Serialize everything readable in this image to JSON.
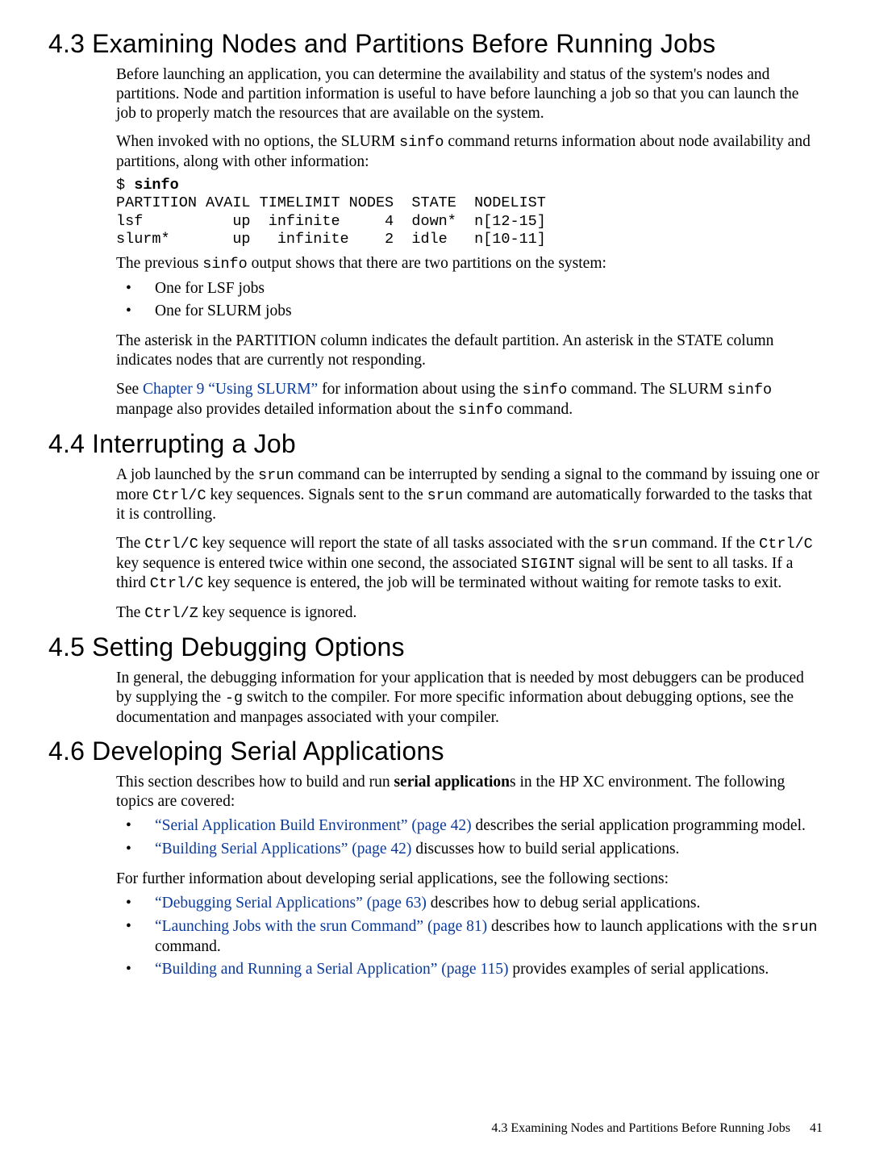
{
  "sections": {
    "s43": {
      "title": "4.3 Examining Nodes and Partitions Before Running Jobs",
      "p1": "Before launching an application, you can determine the availability and status of the system's nodes and partitions. Node and partition information is useful to have before launching a job so that you can launch the job to properly match the resources that are available on the system.",
      "p2_pre": "When invoked with no options, the SLURM ",
      "p2_code": "sinfo",
      "p2_post": " command returns information about node availability and partitions, along with other information:",
      "code_lines": {
        "prompt_pre": "$ ",
        "prompt_cmd": "sinfo",
        "header": "PARTITION AVAIL TIMELIMIT NODES  STATE  NODELIST",
        "row1": "lsf          up  infinite     4  down*  n[12-15]",
        "row2": "slurm*       up   infinite    2  idle   n[10-11]"
      },
      "p3_pre": "The previous ",
      "p3_code": "sinfo",
      "p3_post": " output shows that there are two partitions on the system:",
      "bullets": {
        "b1": "One for LSF jobs",
        "b2": "One for SLURM jobs"
      },
      "p4": "The asterisk in the PARTITION column indicates the default partition. An asterisk in the STATE column indicates nodes that are currently not responding.",
      "p5_pre": "See ",
      "p5_link": "Chapter 9 “Using SLURM”",
      "p5_mid": " for information about using the ",
      "p5_code1": "sinfo",
      "p5_mid2": " command. The SLURM ",
      "p5_code2": "sinfo",
      "p5_mid3": " manpage also provides detailed information about the ",
      "p5_code3": "sinfo",
      "p5_post": " command."
    },
    "s44": {
      "title": "4.4 Interrupting a Job",
      "p1_pre": "A job launched by the ",
      "p1_code1": "srun",
      "p1_mid1": " command can be interrupted by sending a signal to the command by issuing one or more ",
      "p1_code2": "Ctrl/C",
      "p1_mid2": " key sequences. Signals sent to the ",
      "p1_code3": "srun",
      "p1_post": " command are automatically forwarded to the tasks that it is controlling.",
      "p2_pre": "The ",
      "p2_code1": "Ctrl/C",
      "p2_mid1": " key sequence will report the state of all tasks associated with the ",
      "p2_code2": "srun",
      "p2_mid2": " command. If the ",
      "p2_code3": "Ctrl/C",
      "p2_mid3": " key sequence is entered twice within one second, the associated ",
      "p2_code4": "SIGINT",
      "p2_mid4": " signal will be sent to all tasks. If a third ",
      "p2_code5": "Ctrl/C",
      "p2_post": " key sequence is entered, the job will be terminated without waiting for remote tasks to exit.",
      "p3_pre": "The ",
      "p3_code": "Ctrl/Z",
      "p3_post": " key sequence is ignored."
    },
    "s45": {
      "title": "4.5 Setting Debugging Options",
      "p1_pre": "In general, the debugging information for your application that is needed by most debuggers can be produced by supplying the ",
      "p1_code": "-g",
      "p1_post": " switch to the compiler. For more specific information about debugging options, see the documentation and manpages associated with your compiler."
    },
    "s46": {
      "title": "4.6 Developing Serial Applications",
      "p1_pre": "This section describes how to build and run ",
      "p1_bold": "serial application",
      "p1_post": "s in the HP XC environment. The following topics are covered:",
      "list1": {
        "b1_link": "“Serial Application Build Environment” (page 42)",
        "b1_tail": " describes the serial application programming model.",
        "b2_link": "“Building Serial Applications” (page 42)",
        "b2_tail": " discusses how to build serial applications."
      },
      "p2": "For further information about developing serial applications, see the following sections:",
      "list2": {
        "b1_link": "“Debugging Serial Applications” (page 63)",
        "b1_tail": " describes how to debug serial applications.",
        "b2_link": "“Launching Jobs with the srun Command” (page 81)",
        "b2_mid": " describes how to launch applications with the ",
        "b2_code": "srun",
        "b2_tail": " command.",
        "b3_link": "“Building and Running a Serial Application” (page 115)",
        "b3_tail": " provides examples of serial applications."
      }
    }
  },
  "footer": {
    "title": "4.3 Examining Nodes and Partitions Before Running Jobs",
    "page": "41"
  }
}
